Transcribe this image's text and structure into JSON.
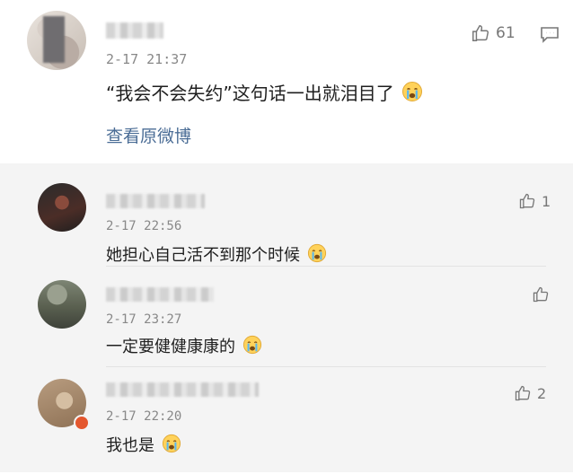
{
  "main_comment": {
    "time": "2-17 21:37",
    "likes": "61",
    "text": "“我会不会失约”这句话一出就泪目了",
    "view_original": "查看原微博"
  },
  "replies": [
    {
      "time": "2-17 22:56",
      "text": "她担心自己活不到那个时候",
      "likes": "1"
    },
    {
      "time": "2-17 23:27",
      "text": "一定要健健康康的",
      "likes": ""
    },
    {
      "time": "2-17 22:20",
      "text": "我也是",
      "likes": "2"
    }
  ],
  "icons": {
    "like": "thumbs-up-icon",
    "comment": "message-icon",
    "emoji": "crying-face-emoji"
  },
  "colors": {
    "link": "#4b6d96",
    "muted": "#888888",
    "reply_bg": "#f4f4f4"
  }
}
